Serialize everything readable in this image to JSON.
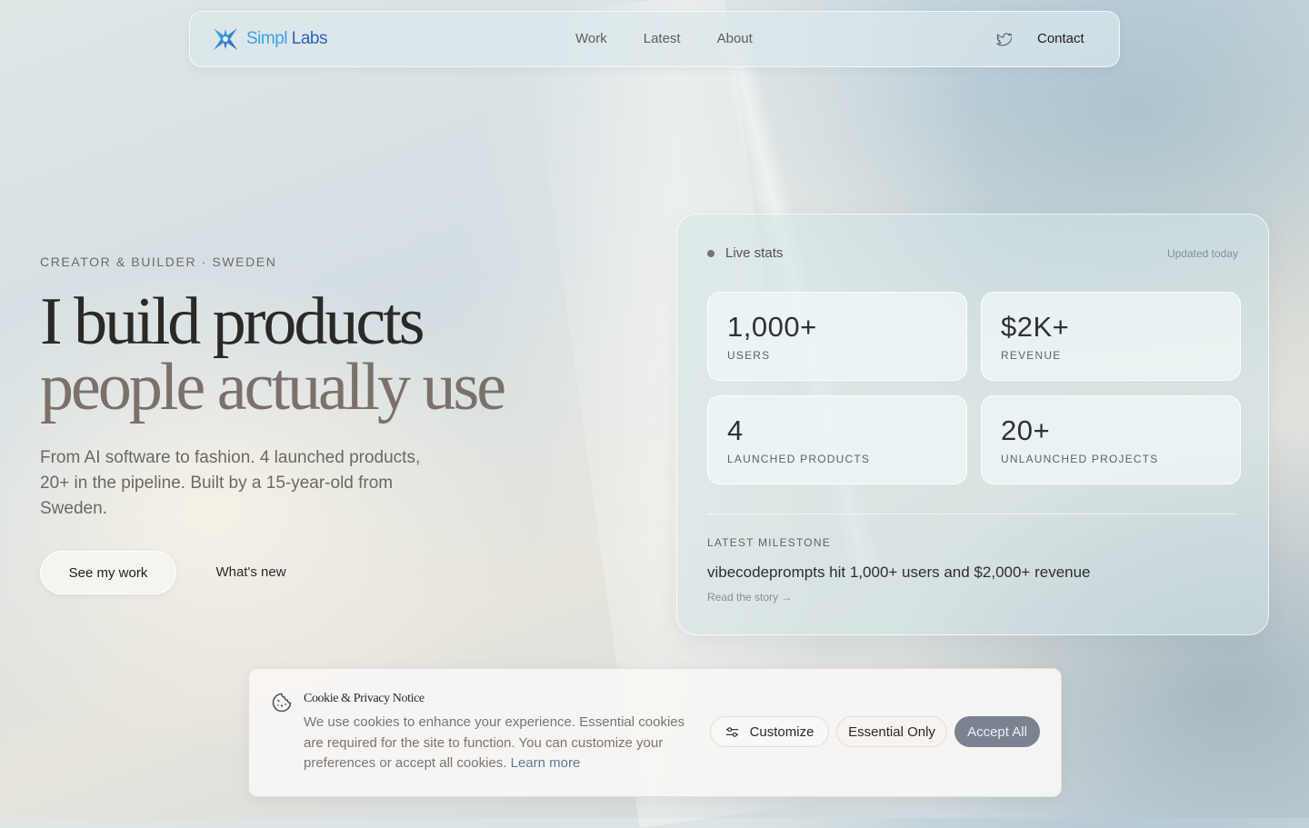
{
  "nav": {
    "logo_simpl": "Simpl",
    "logo_labs": "Labs",
    "links": [
      "Work",
      "Latest",
      "About"
    ],
    "twitter_icon": "twitter-icon",
    "contact": "Contact"
  },
  "hero": {
    "eyebrow": "CREATOR & BUILDER · SWEDEN",
    "title_line1": "I build products",
    "title_line2": "people actually use",
    "lead": "From AI software to fashion. 4 launched products, 20+ in the pipeline. Built by a 15-year-old from Sweden.",
    "primary_cta": "See my work",
    "secondary_cta": "What's new"
  },
  "stats": {
    "live_label": "Live stats",
    "updated": "Updated today",
    "items": [
      {
        "value": "1,000+",
        "label": "USERS"
      },
      {
        "value": "$2K+",
        "label": "REVENUE"
      },
      {
        "value": "4",
        "label": "LAUNCHED PRODUCTS"
      },
      {
        "value": "20+",
        "label": "UNLAUNCHED PROJECTS"
      }
    ],
    "milestone_label": "LATEST MILESTONE",
    "milestone_title": "vibecodeprompts hit 1,000+ users and $2,000+ revenue",
    "milestone_link": "Read the story →"
  },
  "cookie": {
    "icon": "cookie-icon",
    "title": "Cookie & Privacy Notice",
    "text": "We use cookies to enhance your experience. Essential cookies are required for the site to function. You can customize your preferences or accept all cookies.",
    "learn_more": "Learn more",
    "customize": "Customize",
    "essential_only": "Essential Only",
    "accept_all": "Accept All"
  },
  "colors": {
    "accent_blue": "#3aa3e6",
    "brand_dark_blue": "#2d63b8",
    "accept_button": "#7b8290"
  }
}
